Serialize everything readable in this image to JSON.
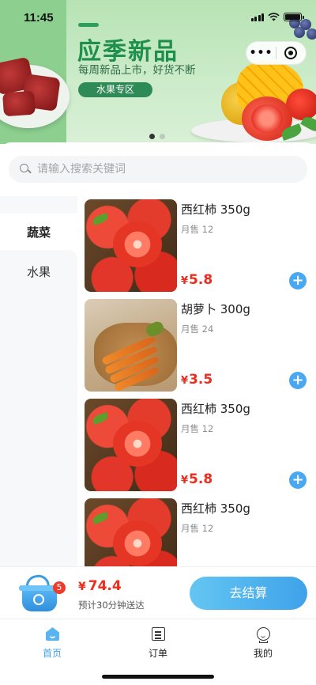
{
  "status_bar": {
    "time": "11:45"
  },
  "banner": {
    "title": "应季新品",
    "subtitle": "每周新品上市，好货不断",
    "tag": "水果专区",
    "slide_count": 2,
    "active_slide": 1
  },
  "capsule": {
    "more": "•••"
  },
  "search": {
    "placeholder": "请输入搜索关键词",
    "value": ""
  },
  "sidebar": {
    "items": [
      {
        "label": "蔬菜",
        "active": true
      },
      {
        "label": "水果",
        "active": false
      }
    ]
  },
  "products": [
    {
      "name": "西红柿 350g",
      "sales": "月售 12",
      "currency": "¥",
      "price": "5.8",
      "image": "tomato"
    },
    {
      "name": "胡萝卜 300g",
      "sales": "月售 24",
      "currency": "¥",
      "price": "3.5",
      "image": "carrot"
    },
    {
      "name": "西红柿 350g",
      "sales": "月售 12",
      "currency": "¥",
      "price": "5.8",
      "image": "tomato"
    },
    {
      "name": "西红柿 350g",
      "sales": "月售 12",
      "currency": "¥",
      "price": "",
      "image": "tomato"
    }
  ],
  "add_icon": "+",
  "cart": {
    "badge": "5",
    "currency": "¥",
    "total": "74.4",
    "eta": "预计30分钟送达",
    "checkout_label": "去结算"
  },
  "tabbar": {
    "tabs": [
      {
        "label": "首页",
        "icon": "home-icon",
        "active": true
      },
      {
        "label": "订单",
        "icon": "order-icon",
        "active": false
      },
      {
        "label": "我的",
        "icon": "me-icon",
        "active": false
      }
    ]
  },
  "colors": {
    "accent": "#3fa2ea",
    "price": "#ee2b1c",
    "banner_green": "#1f8f4e"
  }
}
